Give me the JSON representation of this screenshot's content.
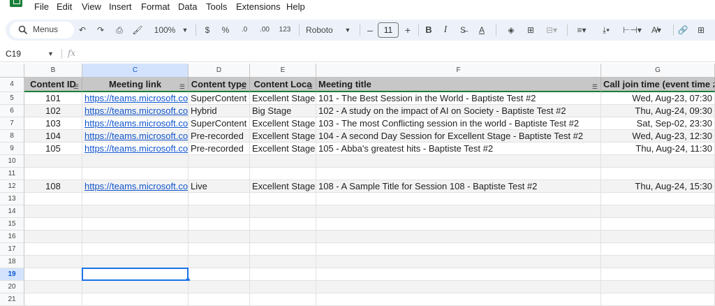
{
  "menu": [
    "File",
    "Edit",
    "View",
    "Insert",
    "Format",
    "Data",
    "Tools",
    "Extensions",
    "Help"
  ],
  "toolbar": {
    "search_placeholder": "Menus",
    "zoom": "100%",
    "currency": "$",
    "percent": "%",
    "dec_decrease": ".0",
    "dec_increase": ".00",
    "number_format": "123",
    "font": "Roboto",
    "font_size": "11",
    "minus": "–",
    "plus": "+",
    "bold": "B",
    "italic": "I"
  },
  "formula_bar": {
    "name_box": "C19",
    "fx": "fx"
  },
  "columns": [
    "B",
    "C",
    "D",
    "E",
    "F",
    "G"
  ],
  "header_row": {
    "row_num": "4",
    "cells": [
      "Content ID",
      "Meeting link",
      "Content type",
      "Content Loca",
      "Meeting title",
      "Call join time (event time zo"
    ]
  },
  "rows": [
    {
      "num": "5",
      "id": "101",
      "link": "https://teams.microsoft.co",
      "type": "SuperContent",
      "loc": "Excellent Stage",
      "title": "101 - The Best Session in the World - Baptiste Test #2",
      "time": "Wed, Aug-23, 07:30"
    },
    {
      "num": "6",
      "id": "102",
      "link": "https://teams.microsoft.co",
      "type": "Hybrid",
      "loc": "Big Stage",
      "title": "102 - A study on the impact of AI on Society - Baptiste Test #2",
      "time": "Thu, Aug-24, 09:30"
    },
    {
      "num": "7",
      "id": "103",
      "link": "https://teams.microsoft.co",
      "type": "SuperContent",
      "loc": "Excellent Stage",
      "title": "103 - The most Conflicting session in the world - Baptiste Test #2",
      "time": "Sat, Sep-02, 23:30"
    },
    {
      "num": "8",
      "id": "104",
      "link": "https://teams.microsoft.co",
      "type": "Pre-recorded",
      "loc": "Excellent Stage",
      "title": "104 - A second Day Session for Excellent Stage - Baptiste Test #2",
      "time": "Wed, Aug-23, 12:30"
    },
    {
      "num": "9",
      "id": "105",
      "link": "https://teams.microsoft.co",
      "type": "Pre-recorded",
      "loc": "Excellent Stage",
      "title": "105 - Abba's greatest hits - Baptiste Test #2",
      "time": "Thu, Aug-24, 11:30"
    },
    {
      "num": "10",
      "id": "",
      "link": "",
      "type": "",
      "loc": "",
      "title": "",
      "time": ""
    },
    {
      "num": "11",
      "id": "",
      "link": "",
      "type": "",
      "loc": "",
      "title": "",
      "time": ""
    },
    {
      "num": "12",
      "id": "108",
      "link": "https://teams.microsoft.co",
      "type": "Live",
      "loc": "Excellent Stage",
      "title": "108 - A Sample Title for Session 108 - Baptiste Test #2",
      "time": "Thu, Aug-24, 15:30"
    },
    {
      "num": "13",
      "id": "",
      "link": "",
      "type": "",
      "loc": "",
      "title": "",
      "time": ""
    },
    {
      "num": "14",
      "id": "",
      "link": "",
      "type": "",
      "loc": "",
      "title": "",
      "time": ""
    },
    {
      "num": "15",
      "id": "",
      "link": "",
      "type": "",
      "loc": "",
      "title": "",
      "time": ""
    },
    {
      "num": "16",
      "id": "",
      "link": "",
      "type": "",
      "loc": "",
      "title": "",
      "time": ""
    },
    {
      "num": "17",
      "id": "",
      "link": "",
      "type": "",
      "loc": "",
      "title": "",
      "time": ""
    },
    {
      "num": "18",
      "id": "",
      "link": "",
      "type": "",
      "loc": "",
      "title": "",
      "time": ""
    },
    {
      "num": "19",
      "id": "",
      "link": "",
      "type": "",
      "loc": "",
      "title": "",
      "time": ""
    },
    {
      "num": "20",
      "id": "",
      "link": "",
      "type": "",
      "loc": "",
      "title": "",
      "time": ""
    },
    {
      "num": "21",
      "id": "",
      "link": "",
      "type": "",
      "loc": "",
      "title": "",
      "time": ""
    }
  ],
  "colors": {
    "accent": "#1a73e8",
    "header_fill": "#c7c7c7",
    "selected_header": "#d3e3fd",
    "link": "#1155cc",
    "toolbar_bg": "#edf2fa"
  }
}
